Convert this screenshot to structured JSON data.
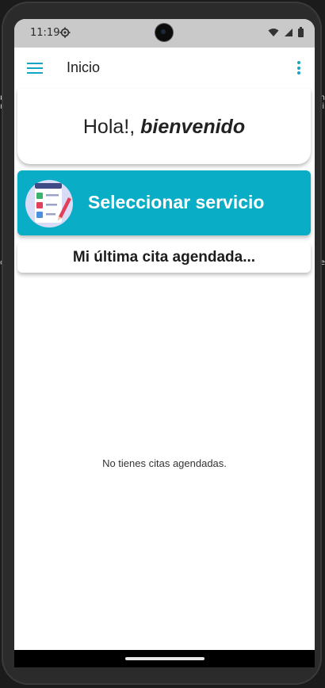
{
  "status_bar": {
    "time": "11:19",
    "icons": [
      "gear-icon",
      "wifi-icon",
      "signal-icon",
      "battery-icon"
    ]
  },
  "app_bar": {
    "title": "Inicio",
    "menu_icon": "hamburger-menu-icon",
    "more_icon": "more-vert-icon"
  },
  "welcome": {
    "greeting": "Hola!,",
    "emphasis": "bienvenido"
  },
  "service_card": {
    "label": "Seleccionar servicio",
    "icon": "checklist-icon"
  },
  "last_appointment": {
    "title": "Mi última cita agendada...",
    "empty_message": "No tienes citas agendadas."
  },
  "colors": {
    "accent": "#0aadc6",
    "menu_icon": "#11a6c6"
  }
}
